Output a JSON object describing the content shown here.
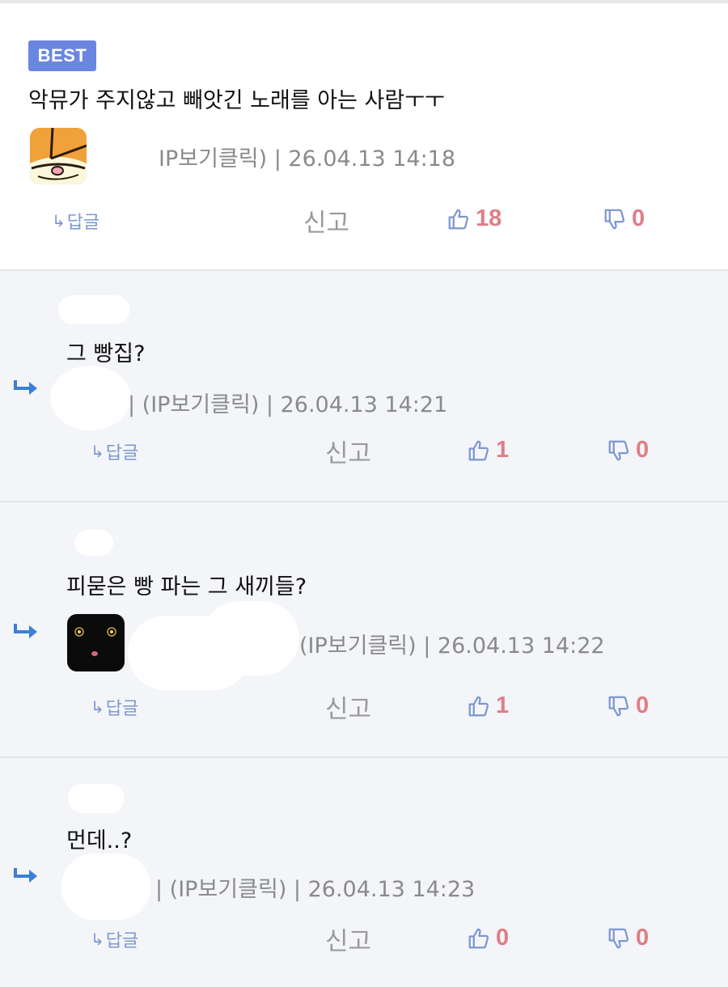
{
  "best": {
    "badge": "BEST",
    "text": "악뮤가 주지않고 빼앗긴 노래를 아는 사람ㅜㅜ",
    "meta": "IP보기클릭) | 26.04.13 14:18",
    "reply_label": "답글",
    "report_label": "신고",
    "likes": "18",
    "dislikes": "0"
  },
  "replies": [
    {
      "text": "그 빵집?",
      "meta": "| (IP보기클릭) | 26.04.13 14:21",
      "reply_label": "답글",
      "report_label": "신고",
      "likes": "1",
      "dislikes": "0"
    },
    {
      "text": "피묻은 빵 파는 그 새끼들?",
      "meta": "(IP보기클릭) | 26.04.13 14:22",
      "reply_label": "답글",
      "report_label": "신고",
      "likes": "1",
      "dislikes": "0"
    },
    {
      "text": "먼데..?",
      "meta": "| (IP보기클릭) | 26.04.13 14:23",
      "reply_label": "답글",
      "report_label": "신고",
      "likes": "0",
      "dislikes": "0"
    }
  ],
  "colors": {
    "badge": "#6b86e0",
    "reply_link": "#7d97cf",
    "count": "#e07d86",
    "reply_arrow": "#3c7fd6",
    "reply_bg": "#f3f5f8"
  },
  "icons": [
    "reply-arrow-icon",
    "thumbs-up-icon",
    "thumbs-down-icon",
    "reply-indent-arrow-icon"
  ]
}
